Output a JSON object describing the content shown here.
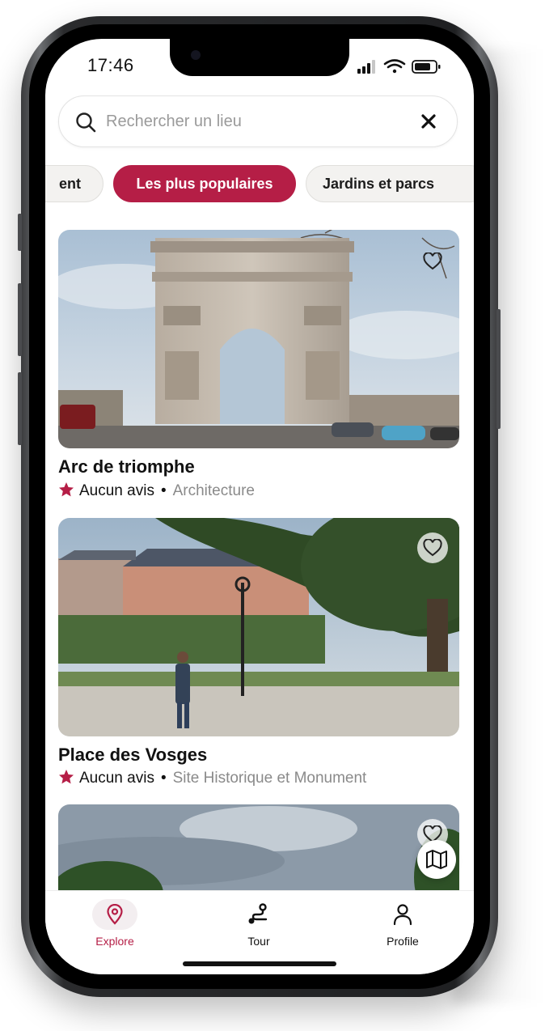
{
  "status_bar": {
    "time": "17:46"
  },
  "search": {
    "placeholder": "Rechercher un lieu"
  },
  "chips": [
    {
      "label": "ent"
    },
    {
      "label": "Les plus populaires",
      "active": true
    },
    {
      "label": "Jardins et parcs"
    }
  ],
  "places": [
    {
      "title": "Arc de triomphe",
      "rating": "Aucun avis",
      "separator": "•",
      "category": "Architecture"
    },
    {
      "title": "Place des Vosges",
      "rating": "Aucun avis",
      "separator": "•",
      "category": "Site Historique et Monument"
    }
  ],
  "tabs": [
    {
      "label": "Explore",
      "icon": "location-pin-icon",
      "active": true
    },
    {
      "label": "Tour",
      "icon": "route-icon"
    },
    {
      "label": "Profile",
      "icon": "person-icon"
    }
  ],
  "colors": {
    "accent": "#b51e46",
    "star": "#b51e46",
    "text": "#111111",
    "muted": "#8a8a8a"
  }
}
